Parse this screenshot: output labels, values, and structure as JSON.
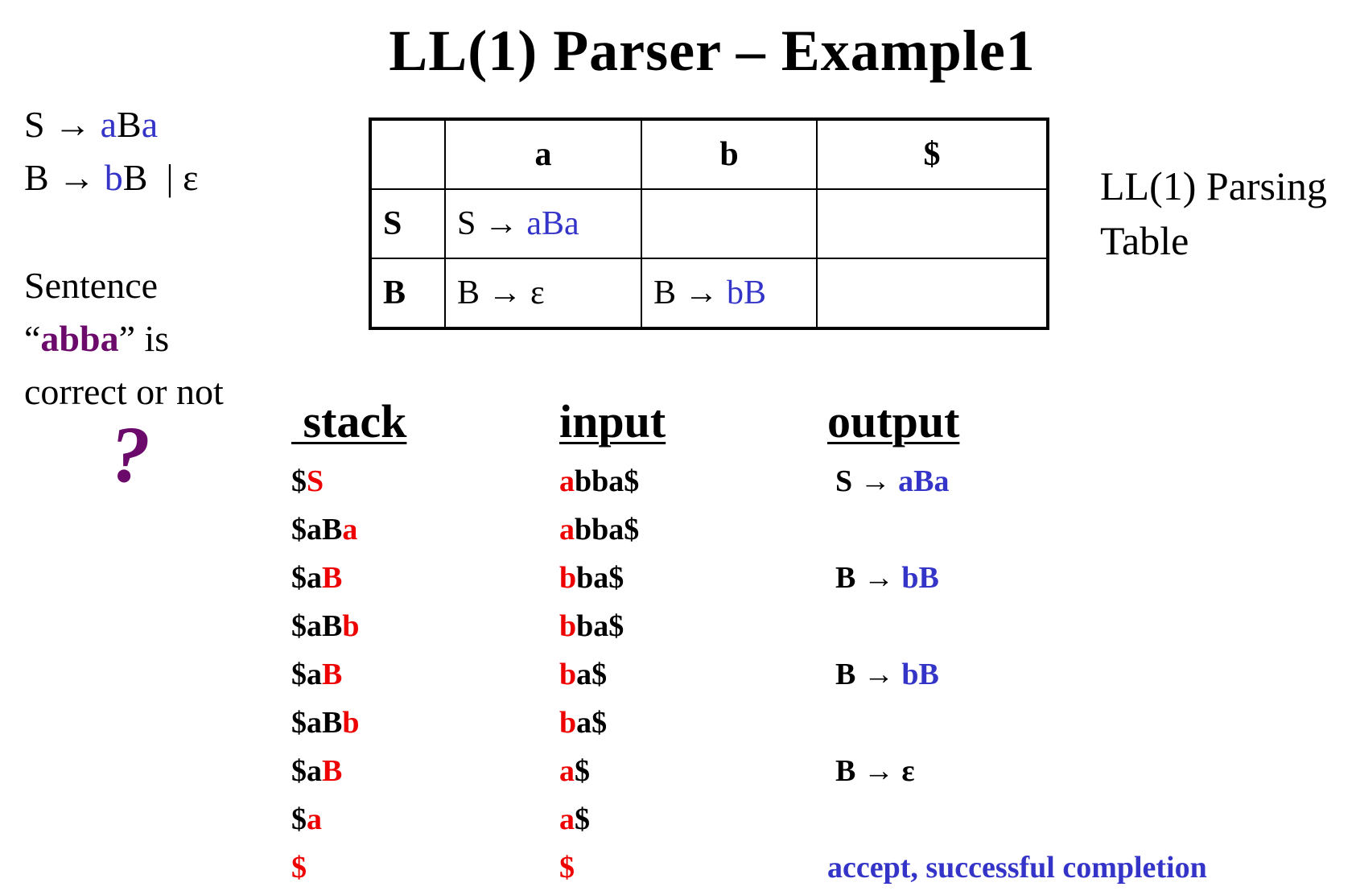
{
  "title": "LL(1) Parser – Example1",
  "grammar": {
    "rule1": {
      "lhs": "S",
      "arrow": "→",
      "rhs_a1": "a",
      "rhs_B": "B",
      "rhs_a2": "a"
    },
    "rule2": {
      "lhs": "B",
      "arrow": "→",
      "rhs_b": "b",
      "rhs_B": "B",
      "sep": "|",
      "eps": "ε"
    }
  },
  "question": {
    "line1": "Sentence",
    "open_quote": "“",
    "word": "abba",
    "close": "” is",
    "line3": "correct or not",
    "mark": "?"
  },
  "parse_table": {
    "headers": [
      "",
      "a",
      "b",
      "$"
    ],
    "rows": [
      {
        "nt": "S",
        "a": {
          "lhs": "S",
          "arrow": "→",
          "rhs": "aBa"
        },
        "b": "",
        "end": ""
      },
      {
        "nt": "B",
        "a": {
          "lhs": "B",
          "arrow": "→",
          "rhs": "ε"
        },
        "b": {
          "lhs": "B",
          "arrow": "→",
          "rhs": "bB"
        },
        "end": ""
      }
    ],
    "label_line1": "LL(1) Parsing",
    "label_line2": "Table"
  },
  "trace": {
    "headers": {
      "stack": " stack",
      "input": "input",
      "output": "output"
    },
    "rows": [
      {
        "stack_rest": "$",
        "stack_top": "S",
        "input_head": "a",
        "input_rest": "bba$",
        "output_lhs": "S → ",
        "output_rhs": "aBa"
      },
      {
        "stack_rest": "$aB",
        "stack_top": "a",
        "input_head": "a",
        "input_rest": "bba$",
        "output_lhs": "",
        "output_rhs": ""
      },
      {
        "stack_rest": "$a",
        "stack_top": "B",
        "input_head": "b",
        "input_rest": "ba$",
        "output_lhs": "B → ",
        "output_rhs": "bB"
      },
      {
        "stack_rest": "$aB",
        "stack_top": "b",
        "input_head": "b",
        "input_rest": "ba$",
        "output_lhs": "",
        "output_rhs": ""
      },
      {
        "stack_rest": "$a",
        "stack_top": "B",
        "input_head": "b",
        "input_rest": "a$",
        "output_lhs": "B → ",
        "output_rhs": "bB"
      },
      {
        "stack_rest": "$aB",
        "stack_top": "b",
        "input_head": "b",
        "input_rest": "a$",
        "output_lhs": "",
        "output_rhs": ""
      },
      {
        "stack_rest": "$a",
        "stack_top": "B",
        "input_head": "a",
        "input_rest": "$",
        "output_lhs": "B → ε",
        "output_rhs": ""
      },
      {
        "stack_rest": "$",
        "stack_top": "a",
        "input_head": "a",
        "input_rest": "$",
        "output_lhs": "",
        "output_rhs": ""
      },
      {
        "stack_rest": "",
        "stack_top": "$",
        "input_head": "$",
        "input_rest": "",
        "output_lhs": "",
        "output_rhs": ""
      }
    ],
    "final_output": "accept, successful completion"
  },
  "colors": {
    "terminal": "#3434c8",
    "top": "#ee0000",
    "highlight": "#6b0a6b"
  }
}
